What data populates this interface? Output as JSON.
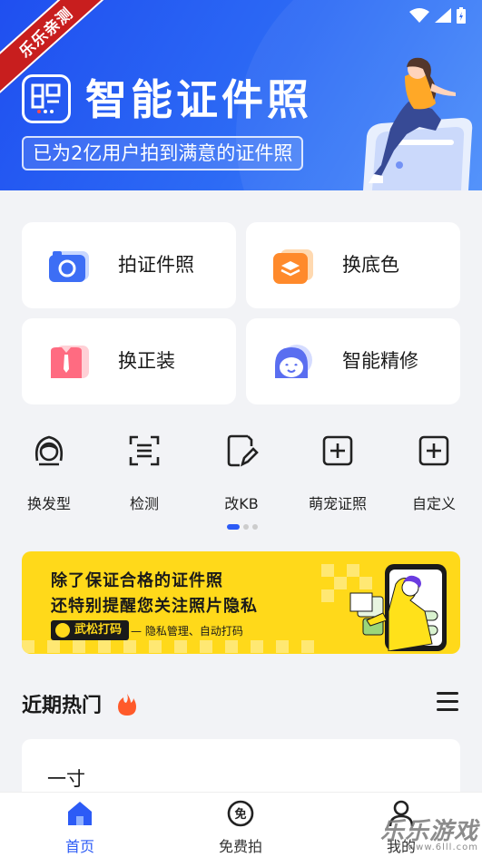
{
  "header": {
    "ribbon": "乐乐亲测",
    "title": "智能证件照",
    "slogan": "已为2亿用户拍到满意的证件照"
  },
  "features": [
    {
      "label": "拍证件照",
      "icon": "camera-icon"
    },
    {
      "label": "换底色",
      "icon": "layers-icon"
    },
    {
      "label": "换正装",
      "icon": "suit-icon"
    },
    {
      "label": "智能精修",
      "icon": "face-retouch-icon"
    }
  ],
  "tools": [
    {
      "label": "换发型",
      "icon": "hairstyle-icon"
    },
    {
      "label": "检测",
      "icon": "scan-icon"
    },
    {
      "label": "改KB",
      "icon": "edit-file-icon"
    },
    {
      "label": "萌宠证照",
      "icon": "add-square-icon"
    },
    {
      "label": "自定义",
      "icon": "add-square-icon"
    }
  ],
  "carousel": {
    "pages": 3,
    "active": 0
  },
  "banner": {
    "line1": "除了保证合格的证件照",
    "line2": "还特别提醒您关注照片隐私",
    "tag": "武松打码",
    "desc": "— 隐私管理、自动打码"
  },
  "hot": {
    "title": "近期热门",
    "first_item": "一寸"
  },
  "nav": [
    {
      "label": "首页",
      "icon": "home-icon",
      "active": true
    },
    {
      "label": "免费拍",
      "icon": "free-icon",
      "active": false
    },
    {
      "label": "我的",
      "icon": "user-icon",
      "active": false
    }
  ],
  "watermark": {
    "brand": "乐乐游戏",
    "site": "www.6lll.com"
  },
  "colors": {
    "primary": "#2c5bf6",
    "banner": "#ffd91a",
    "ribbon": "#c81e1e"
  }
}
